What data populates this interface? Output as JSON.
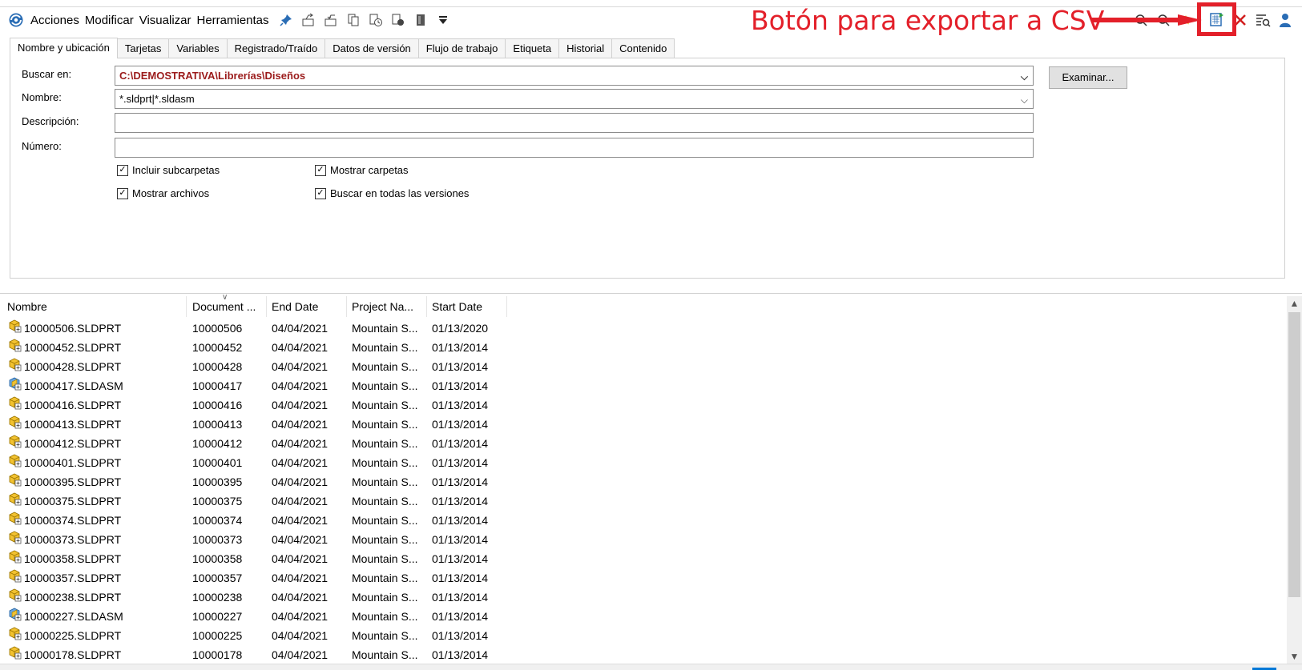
{
  "menu": [
    "Acciones",
    "Modificar",
    "Visualizar",
    "Herramientas"
  ],
  "toolbar_icons": [
    "pin-icon",
    "checkout-icon",
    "checkin-icon",
    "copy-tree-icon",
    "get-version-icon",
    "preview-icon",
    "vault-icon",
    "dropdown-arrow-icon"
  ],
  "toolbar_right_icons": [
    "search-icon",
    "search-icon",
    "star-icon",
    "export-csv-icon",
    "clear-icon",
    "search-list-icon",
    "user-icon"
  ],
  "annotation": {
    "text": "Botón para exportar a CSV",
    "color": "#e3202a"
  },
  "tabs": [
    "Nombre y ubicación",
    "Tarjetas",
    "Variables",
    "Registrado/Traído",
    "Datos de versión",
    "Flujo de trabajo",
    "Etiqueta",
    "Historial",
    "Contenido"
  ],
  "active_tab": 0,
  "form": {
    "buscar_label": "Buscar en:",
    "buscar_value": "C:\\DEMOSTRATIVA\\Librerías\\Diseños",
    "nombre_label": "Nombre:",
    "nombre_value": "*.sldprt|*.sldasm",
    "descripcion_label": "Descripción:",
    "descripcion_value": "",
    "numero_label": "Número:",
    "numero_value": "",
    "browse_label": "Examinar...",
    "checkboxes": [
      {
        "label": "Incluir subcarpetas",
        "checked": true
      },
      {
        "label": "Mostrar carpetas",
        "checked": true
      },
      {
        "label": "Mostrar archivos",
        "checked": true
      },
      {
        "label": "Buscar en todas las versiones",
        "checked": true
      }
    ]
  },
  "list": {
    "columns": [
      "Nombre",
      "Document ...",
      "End Date",
      "Project Na...",
      "Start Date"
    ],
    "rows": [
      {
        "type": "part",
        "name": "10000506.SLDPRT",
        "doc": "10000506",
        "end": "04/04/2021",
        "project": "Mountain S...",
        "start": "01/13/2020"
      },
      {
        "type": "part",
        "name": "10000452.SLDPRT",
        "doc": "10000452",
        "end": "04/04/2021",
        "project": "Mountain S...",
        "start": "01/13/2014"
      },
      {
        "type": "part",
        "name": "10000428.SLDPRT",
        "doc": "10000428",
        "end": "04/04/2021",
        "project": "Mountain S...",
        "start": "01/13/2014"
      },
      {
        "type": "assembly",
        "name": "10000417.SLDASM",
        "doc": "10000417",
        "end": "04/04/2021",
        "project": "Mountain S...",
        "start": "01/13/2014"
      },
      {
        "type": "part",
        "name": "10000416.SLDPRT",
        "doc": "10000416",
        "end": "04/04/2021",
        "project": "Mountain S...",
        "start": "01/13/2014"
      },
      {
        "type": "part",
        "name": "10000413.SLDPRT",
        "doc": "10000413",
        "end": "04/04/2021",
        "project": "Mountain S...",
        "start": "01/13/2014"
      },
      {
        "type": "part",
        "name": "10000412.SLDPRT",
        "doc": "10000412",
        "end": "04/04/2021",
        "project": "Mountain S...",
        "start": "01/13/2014"
      },
      {
        "type": "part",
        "name": "10000401.SLDPRT",
        "doc": "10000401",
        "end": "04/04/2021",
        "project": "Mountain S...",
        "start": "01/13/2014"
      },
      {
        "type": "part",
        "name": "10000395.SLDPRT",
        "doc": "10000395",
        "end": "04/04/2021",
        "project": "Mountain S...",
        "start": "01/13/2014"
      },
      {
        "type": "part",
        "name": "10000375.SLDPRT",
        "doc": "10000375",
        "end": "04/04/2021",
        "project": "Mountain S...",
        "start": "01/13/2014"
      },
      {
        "type": "part",
        "name": "10000374.SLDPRT",
        "doc": "10000374",
        "end": "04/04/2021",
        "project": "Mountain S...",
        "start": "01/13/2014"
      },
      {
        "type": "part",
        "name": "10000373.SLDPRT",
        "doc": "10000373",
        "end": "04/04/2021",
        "project": "Mountain S...",
        "start": "01/13/2014"
      },
      {
        "type": "part",
        "name": "10000358.SLDPRT",
        "doc": "10000358",
        "end": "04/04/2021",
        "project": "Mountain S...",
        "start": "01/13/2014"
      },
      {
        "type": "part",
        "name": "10000357.SLDPRT",
        "doc": "10000357",
        "end": "04/04/2021",
        "project": "Mountain S...",
        "start": "01/13/2014"
      },
      {
        "type": "part",
        "name": "10000238.SLDPRT",
        "doc": "10000238",
        "end": "04/04/2021",
        "project": "Mountain S...",
        "start": "01/13/2014"
      },
      {
        "type": "assembly",
        "name": "10000227.SLDASM",
        "doc": "10000227",
        "end": "04/04/2021",
        "project": "Mountain S...",
        "start": "01/13/2014"
      },
      {
        "type": "part",
        "name": "10000225.SLDPRT",
        "doc": "10000225",
        "end": "04/04/2021",
        "project": "Mountain S...",
        "start": "01/13/2014"
      },
      {
        "type": "part",
        "name": "10000178.SLDPRT",
        "doc": "10000178",
        "end": "04/04/2021",
        "project": "Mountain S...",
        "start": "01/13/2014"
      }
    ]
  }
}
